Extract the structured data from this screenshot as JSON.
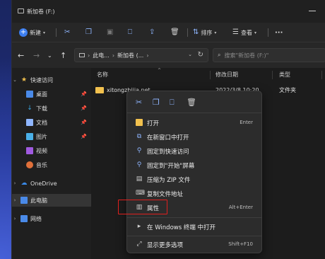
{
  "window": {
    "title": "新加卷 (F:)"
  },
  "toolbar": {
    "new_label": "新建",
    "sort_label": "排序",
    "view_label": "查看",
    "more_label": "···"
  },
  "address": {
    "path_part1": "此电...",
    "path_sep": "›",
    "path_part2": "新加卷 (...",
    "search_placeholder": "搜索\"新加卷 (F:)\""
  },
  "sidebar": {
    "items": [
      {
        "label": "快速访问",
        "icon": "star-icon",
        "color": "#f2c14e"
      },
      {
        "label": "桌面",
        "icon": "desktop-icon",
        "color": "#4a8ae8"
      },
      {
        "label": "下载",
        "icon": "download-icon",
        "color": "#3aa6e0"
      },
      {
        "label": "文档",
        "icon": "document-icon",
        "color": "#8fb6ff"
      },
      {
        "label": "图片",
        "icon": "picture-icon",
        "color": "#4ab0e8"
      },
      {
        "label": "视频",
        "icon": "video-icon",
        "color": "#a05ae0"
      },
      {
        "label": "音乐",
        "icon": "music-icon",
        "color": "#e0703a"
      },
      {
        "label": "OneDrive",
        "icon": "cloud-icon",
        "color": "#3a8ae8"
      },
      {
        "label": "此电脑",
        "icon": "computer-icon",
        "color": "#4a8ae8"
      },
      {
        "label": "网络",
        "icon": "network-icon",
        "color": "#4a8ae8"
      }
    ]
  },
  "columns": {
    "name": "名称",
    "date": "修改日期",
    "type": "类型",
    "size": "大"
  },
  "file": {
    "name": "xitongzhijia.net",
    "date": "2022/3/8 10:20",
    "type": "文件夹"
  },
  "context_menu": {
    "items": [
      {
        "label": "打开",
        "shortcut": "Enter",
        "icon": "folder-open-icon"
      },
      {
        "label": "在新窗口中打开",
        "shortcut": "",
        "icon": "new-window-icon"
      },
      {
        "label": "固定到快速访问",
        "shortcut": "",
        "icon": "pin-icon"
      },
      {
        "label": "固定到\"开始\"屏幕",
        "shortcut": "",
        "icon": "pin-start-icon"
      },
      {
        "label": "压缩为 ZIP 文件",
        "shortcut": "",
        "icon": "zip-icon"
      },
      {
        "label": "复制文件地址",
        "shortcut": "",
        "icon": "copy-path-icon"
      },
      {
        "label": "属性",
        "shortcut": "Alt+Enter",
        "icon": "properties-icon"
      },
      {
        "label": "在 Windows 终端 中打开",
        "shortcut": "",
        "icon": "terminal-icon"
      },
      {
        "label": "显示更多选项",
        "shortcut": "Shift+F10",
        "icon": "more-options-icon"
      }
    ]
  },
  "colors": {
    "accent": "#3c7ef0",
    "highlight_box": "#e0201e",
    "folder": "#f2c14e"
  }
}
